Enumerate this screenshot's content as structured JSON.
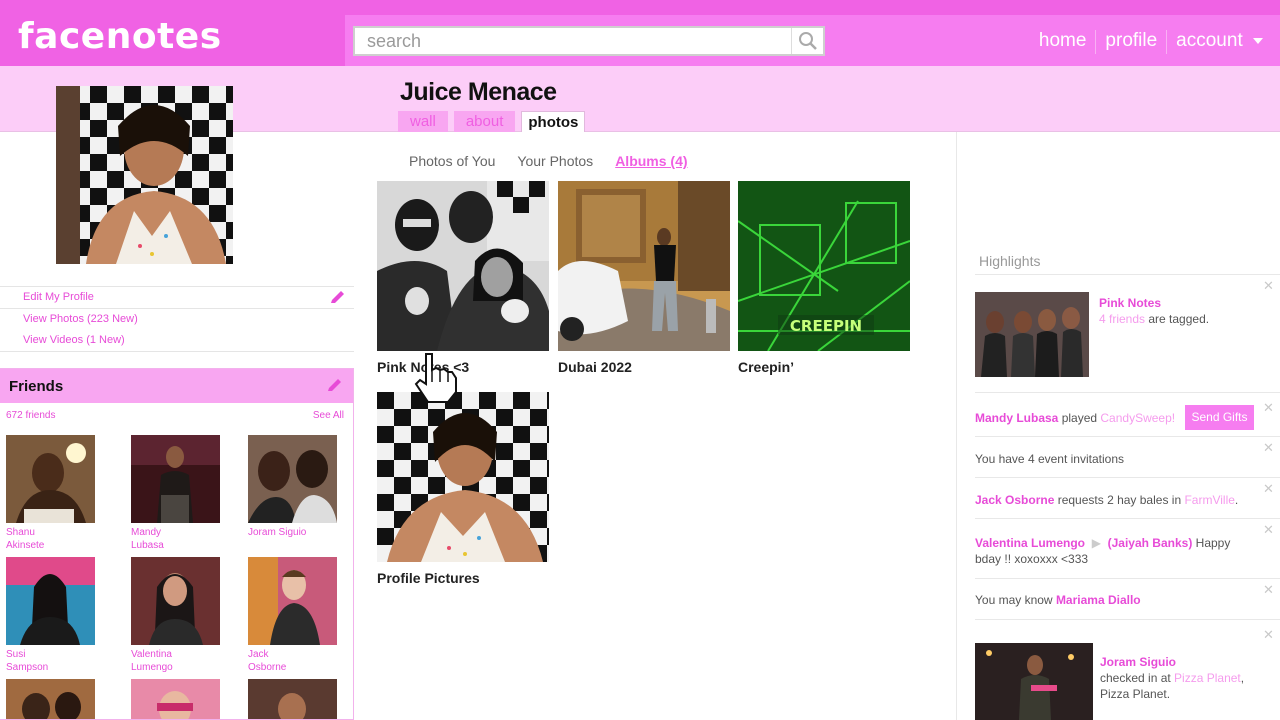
{
  "app": {
    "logo": "facenotes"
  },
  "search": {
    "placeholder": "search"
  },
  "nav": {
    "home": "home",
    "profile": "profile",
    "account": "account"
  },
  "profile": {
    "name": "Juice Menace",
    "tabs": {
      "wall": "wall",
      "about": "about",
      "photos": "photos"
    },
    "links": {
      "edit": "Edit My Profile",
      "view_photos": "View Photos (223 New)",
      "view_videos": "View Videos (1 New)"
    }
  },
  "friends": {
    "title": "Friends",
    "count": "672 friends",
    "see_all": "See All",
    "list": [
      {
        "name": "Shanu Akinsete"
      },
      {
        "name": "Mandy Lubasa"
      },
      {
        "name": "Joram Siguio"
      },
      {
        "name": "Susi Sampson"
      },
      {
        "name": "Valentina Lumengo"
      },
      {
        "name": "Jack Osborne"
      }
    ]
  },
  "photos": {
    "subtabs": {
      "photos_of_you": "Photos of You",
      "your_photos": "Your Photos",
      "albums": "Albums (4)"
    },
    "albums": [
      {
        "title": "Pink Notes <3"
      },
      {
        "title": "Dubai 2022"
      },
      {
        "title": "Creepin’",
        "overlay": "CREEPIN"
      },
      {
        "title": "Profile Pictures"
      }
    ]
  },
  "highlights": {
    "title": "Highlights",
    "h1": {
      "name": "Pink Notes",
      "tagged": "4 friends",
      "rest": " are tagged."
    },
    "h2": {
      "name": "Mandy Lubasa",
      "verb": " played ",
      "game": "CandySweep!",
      "button": "Send Gifts"
    },
    "h3": {
      "text": "You have 4 event invitations"
    },
    "h4": {
      "name": "Jack Osborne",
      "verb": " requests 2 hay bales in ",
      "game": "FarmVille",
      "end": "."
    },
    "h5": {
      "from": "Valentina Lumengo",
      "to": "(Jaiyah Banks)",
      "msg": " Happy bday !! xoxoxxx <333"
    },
    "h6": {
      "text": "You may know ",
      "name": "Mariama Diallo"
    },
    "h7": {
      "name": "Joram Siguio",
      "text1": "checked in at ",
      "place": "Pizza Planet",
      "text2": ", Pizza Planet."
    }
  },
  "colors": {
    "brand": "#f062e4",
    "link": "#e74bd7",
    "band": "#fccdf8"
  }
}
